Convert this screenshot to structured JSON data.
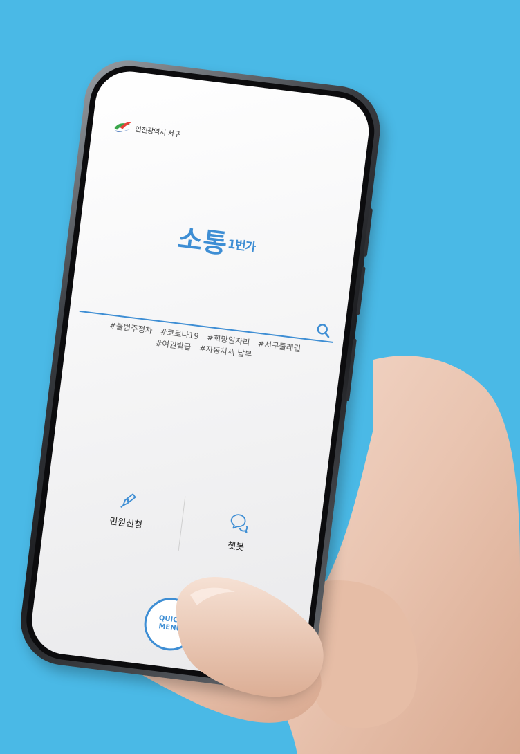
{
  "colors": {
    "background": "#4ab9e6",
    "accent": "#3e8ed4",
    "logo_green": "#3aa64a",
    "logo_red": "#e8423a",
    "logo_blue": "#2a5fb0"
  },
  "header": {
    "org_name": "인천광역시 서구",
    "logo_icon": "incheon-seogu-logo-icon"
  },
  "brand": {
    "main": "소통",
    "sub": "1번가"
  },
  "search": {
    "value": "",
    "placeholder": "",
    "icon": "search-icon"
  },
  "tags": [
    "#불법주정차",
    "#코로나19",
    "#희망일자리",
    "#서구둘레길",
    "#여권발급",
    "#자동차세 납부"
  ],
  "menu": {
    "items": [
      {
        "label": "민원신청",
        "icon": "pen-icon"
      },
      {
        "label": "챗봇",
        "icon": "chat-bubbles-icon"
      }
    ]
  },
  "quick_menu": {
    "line1": "QUICK",
    "line2": "MENU"
  }
}
